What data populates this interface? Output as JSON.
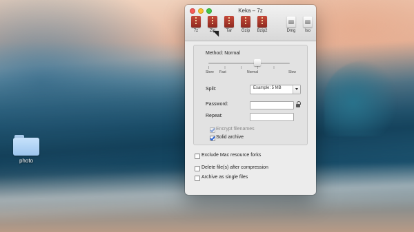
{
  "desktop": {
    "folder": {
      "label": "photo"
    }
  },
  "window": {
    "title": "Keka – 7z",
    "toolbar": {
      "items": [
        {
          "label": "7z",
          "icon": "archive-7z-icon"
        },
        {
          "label": "Zip",
          "icon": "archive-zip-icon"
        },
        {
          "label": "Tar",
          "icon": "archive-tar-icon"
        },
        {
          "label": "Gzip",
          "icon": "archive-gzip-icon"
        },
        {
          "label": "Bzip2",
          "icon": "archive-bzip2-icon"
        },
        {
          "label": "Dmg",
          "icon": "disk-image-dmg-icon"
        },
        {
          "label": "Iso",
          "icon": "disk-image-iso-icon"
        }
      ]
    },
    "panel": {
      "method_label": "Method: Normal",
      "slider": {
        "labels": {
          "store": "Store",
          "fast": "Fast",
          "normal": "Normal",
          "slow": "Slow"
        },
        "value_fraction": 0.6
      },
      "split": {
        "label": "Split:",
        "value": "Example: 5 MB"
      },
      "password": {
        "label": "Password:",
        "value": ""
      },
      "repeat": {
        "label": "Repeat:",
        "value": ""
      },
      "encrypt_filenames": {
        "label": "Encrypt filenames",
        "checked": true,
        "disabled": true
      },
      "solid_archive": {
        "label": "Solid archive",
        "checked": true,
        "disabled": false
      }
    },
    "options": {
      "exclude_mac_forks": {
        "label": "Exclude Mac resource forks",
        "checked": false
      },
      "delete_after": {
        "label": "Delete file(s) after compression",
        "checked": false
      },
      "archive_single": {
        "label": "Archive as single files",
        "checked": false
      }
    }
  }
}
